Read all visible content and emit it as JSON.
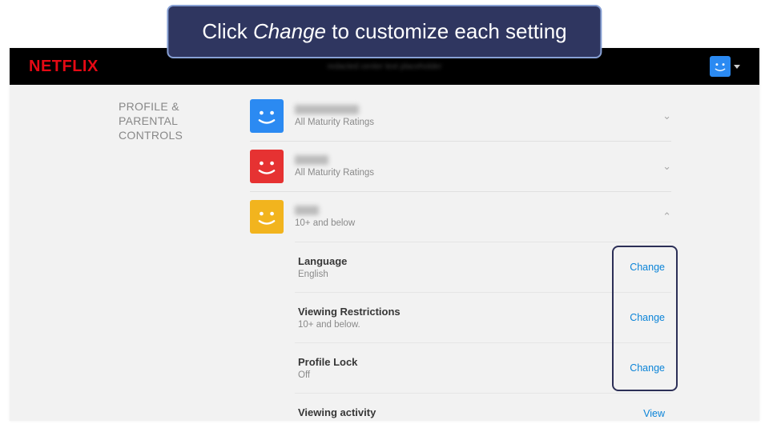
{
  "callout": {
    "prefix": "Click ",
    "emphasis": "Change",
    "suffix": " to customize each setting"
  },
  "brand": {
    "logo": "NETFLIX"
  },
  "section_heading": "PROFILE & PARENTAL CONTROLS",
  "profiles": [
    {
      "name_redacted": true,
      "subtitle": "All Maturity Ratings",
      "avatar_color": "blue",
      "expanded": false
    },
    {
      "name_redacted": true,
      "subtitle": "All Maturity Ratings",
      "avatar_color": "red",
      "expanded": false
    },
    {
      "name_redacted": true,
      "subtitle": "10+ and below",
      "avatar_color": "gold",
      "expanded": true
    }
  ],
  "settings": [
    {
      "title": "Language",
      "value": "English",
      "action": "Change"
    },
    {
      "title": "Viewing Restrictions",
      "value": "10+ and below.",
      "action": "Change"
    },
    {
      "title": "Profile Lock",
      "value": "Off",
      "action": "Change"
    },
    {
      "title": "Viewing activity",
      "value": "",
      "action": "View"
    }
  ],
  "top_profile_avatar": "blue"
}
